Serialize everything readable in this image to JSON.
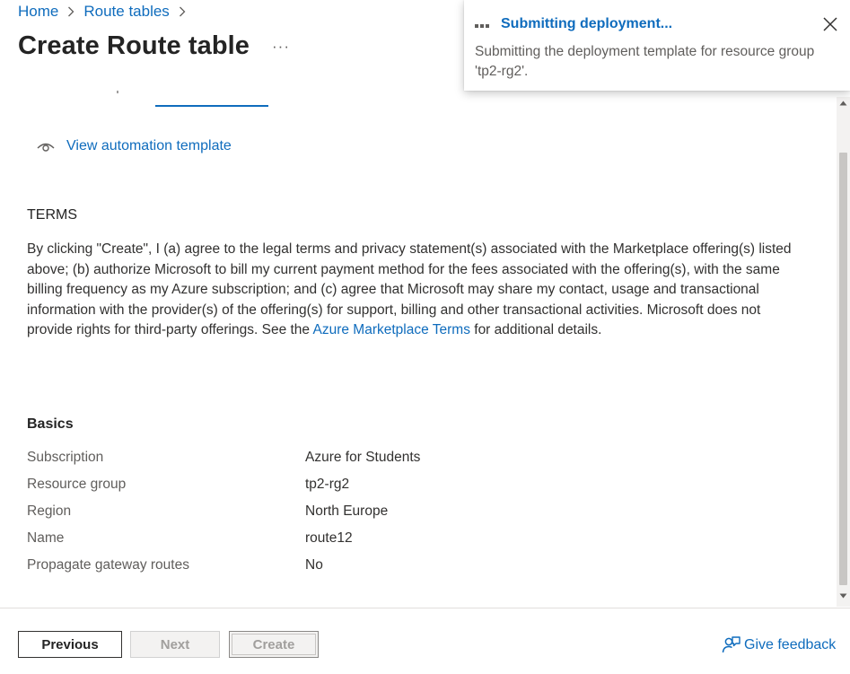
{
  "breadcrumb": {
    "items": [
      {
        "label": "Home"
      },
      {
        "label": "Route tables"
      }
    ]
  },
  "page": {
    "title": "Create Route table",
    "more_label": "···"
  },
  "automation": {
    "link_label": "View automation template"
  },
  "terms": {
    "heading": "TERMS",
    "body_before_link": "By clicking \"Create\", I (a) agree to the legal terms and privacy statement(s) associated with the Marketplace offering(s) listed above; (b) authorize Microsoft to bill my current payment method for the fees associated with the offering(s), with the same billing frequency as my Azure subscription; and (c) agree that Microsoft may share my contact, usage and transactional information with the provider(s) of the offering(s) for support, billing and other transactional activities. Microsoft does not provide rights for third-party offerings. See the ",
    "link_label": "Azure Marketplace Terms",
    "body_after_link": " for additional details."
  },
  "basics": {
    "heading": "Basics",
    "rows": [
      {
        "key": "Subscription",
        "value": "Azure for Students"
      },
      {
        "key": "Resource group",
        "value": "tp2-rg2"
      },
      {
        "key": "Region",
        "value": "North Europe"
      },
      {
        "key": "Name",
        "value": "route12"
      },
      {
        "key": "Propagate gateway routes",
        "value": "No"
      }
    ]
  },
  "footer": {
    "previous_label": "Previous",
    "next_label": "Next",
    "create_label": "Create",
    "feedback_label": "Give feedback"
  },
  "notification": {
    "title": "Submitting deployment...",
    "message": "Submitting the deployment template for resource group 'tp2-rg2'."
  },
  "colors": {
    "accent": "#0f6cbd",
    "text_primary": "#242424",
    "text_secondary": "#605e5c",
    "disabled_text": "#a19f9d"
  },
  "icons": {
    "breadcrumb_separator": "chevron-right-icon",
    "automation": "eye-icon",
    "feedback": "person-feedback-icon",
    "close": "close-icon",
    "progress": "progress-dots-icon"
  }
}
